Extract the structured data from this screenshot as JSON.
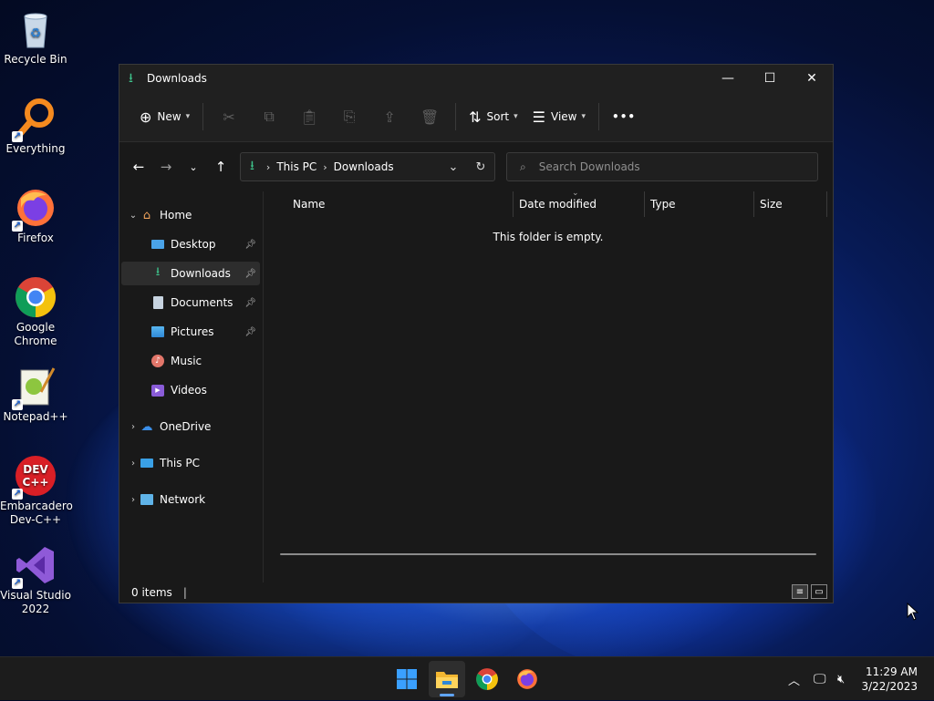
{
  "desktop": {
    "icons": [
      {
        "label": "Recycle Bin",
        "icon": "recycle-bin-icon"
      },
      {
        "label": "Everything",
        "icon": "everything-search-icon"
      },
      {
        "label": "Firefox",
        "icon": "firefox-icon"
      },
      {
        "label": "Google Chrome",
        "icon": "chrome-icon"
      },
      {
        "label": "Notepad++",
        "icon": "notepadpp-icon"
      },
      {
        "label": "Embarcadero Dev-C++",
        "icon": "devcpp-icon",
        "badge": "DEV C++"
      },
      {
        "label": "Visual Studio 2022",
        "icon": "visual-studio-icon"
      }
    ]
  },
  "window": {
    "title": "Downloads",
    "controls": {
      "minimize": "—",
      "maximize": "☐",
      "close": "✕"
    }
  },
  "command_bar": {
    "new_label": "New",
    "sort_label": "Sort",
    "view_label": "View",
    "more_label": "•••"
  },
  "address_bar": {
    "root_sep": "›",
    "crumbs": [
      "This PC",
      "Downloads"
    ]
  },
  "search": {
    "placeholder": "Search Downloads"
  },
  "nav_pane": {
    "home": "Home",
    "quick_access": [
      {
        "label": "Desktop",
        "pinned": true
      },
      {
        "label": "Downloads",
        "pinned": true,
        "selected": true
      },
      {
        "label": "Documents",
        "pinned": true
      },
      {
        "label": "Pictures",
        "pinned": true
      },
      {
        "label": "Music",
        "pinned": false
      },
      {
        "label": "Videos",
        "pinned": false
      }
    ],
    "roots": [
      "OneDrive",
      "This PC",
      "Network"
    ]
  },
  "columns": [
    "Name",
    "Date modified",
    "Type",
    "Size"
  ],
  "sorted_column": "Date modified",
  "empty_message": "This folder is empty.",
  "status": {
    "item_count": "0 items",
    "divider": "|"
  },
  "taskbar": {
    "apps": [
      "start-button",
      "file-explorer",
      "chrome",
      "firefox"
    ],
    "active_app": "file-explorer",
    "time": "11:29 AM",
    "date": "3/22/2023"
  },
  "colors": {
    "accent": "#60a5ff",
    "downloads_green": "#3ec38b",
    "window_bg": "#191919"
  }
}
